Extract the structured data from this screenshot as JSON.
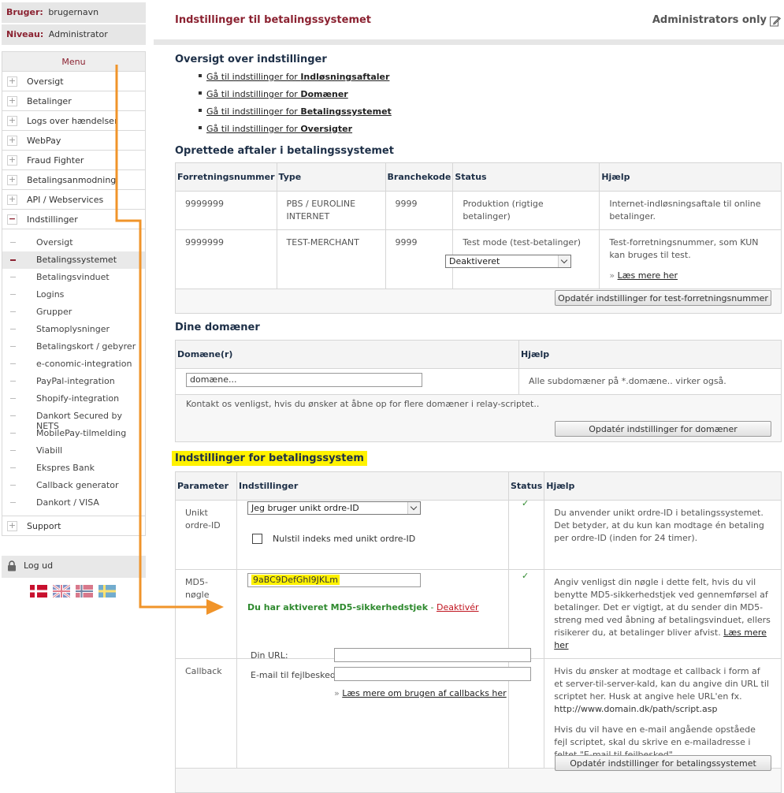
{
  "sidebar": {
    "user_label": "Bruger:",
    "user_value": "brugernavn",
    "level_label": "Niveau:",
    "level_value": "Administrator",
    "menu_title": "Menu",
    "items": [
      {
        "label": "Oversigt",
        "state": "+"
      },
      {
        "label": "Betalinger",
        "state": "+"
      },
      {
        "label": "Logs over hændelser",
        "state": "+"
      },
      {
        "label": "WebPay",
        "state": "+"
      },
      {
        "label": "Fraud Fighter",
        "state": "+"
      },
      {
        "label": "Betalingsanmodning",
        "state": "+"
      },
      {
        "label": "API / Webservices",
        "state": "+"
      },
      {
        "label": "Indstillinger",
        "state": "−"
      }
    ],
    "sub_items": [
      "Oversigt",
      "Betalingssystemet",
      "Betalingsvinduet",
      "Logins",
      "Grupper",
      "Stamoplysninger",
      "Betalingskort / gebyrer",
      "e-conomic-integration",
      "PayPal-integration",
      "Shopify-integration",
      "Dankort Secured by NETS",
      "MobilePay-tilmelding",
      "Viabill",
      "Ekspres Bank",
      "Callback generator",
      "Dankort / VISA"
    ],
    "active_sub": "Betalingssystemet",
    "support_label": "Support",
    "logout_label": "Log ud"
  },
  "header": {
    "title": "Indstillinger til betalingssystemet",
    "admin_only": "Administrators only"
  },
  "overview": {
    "heading": "Oversigt over indstillinger",
    "links": [
      {
        "prefix": "Gå til indstillinger for ",
        "bold": "Indløsningsaftaler"
      },
      {
        "prefix": "Gå til indstillinger for ",
        "bold": "Domæner"
      },
      {
        "prefix": "Gå til indstillinger for ",
        "bold": "Betalingssystemet"
      },
      {
        "prefix": "Gå til indstillinger for ",
        "bold": "Oversigter"
      }
    ]
  },
  "agreements": {
    "heading": "Oprettede aftaler i betalingssystemet",
    "columns": [
      "Forretningsnummer",
      "Type",
      "Branchekode",
      "Status",
      "Hjælp"
    ],
    "rows": [
      {
        "number": "9999999",
        "type": "PBS / EUROLINE INTERNET",
        "code": "9999",
        "status": "Produktion (rigtige betalinger)",
        "help": "Internet-indløsningsaftale til online betalinger."
      },
      {
        "number": "9999999",
        "type": "TEST-MERCHANT",
        "code": "9999",
        "status": "Test mode (test-betalinger)",
        "help": "Test-forretningsnummer, som KUN kan bruges til test."
      }
    ],
    "test_select": "Deaktiveret",
    "read_more": "Læs mere her",
    "button": "Opdatér indstillinger for test-forretningsnummer"
  },
  "domains": {
    "heading": "Dine domæner",
    "columns": [
      "Domæne(r)",
      "Hjælp"
    ],
    "input_value": "domæne...",
    "help": "Alle subdomæner på *.domæne.. virker også.",
    "contact": "Kontakt os venligst, hvis du ønsker at åbne op for flere domæner i relay-scriptet..",
    "button": "Opdatér indstillinger for domæner"
  },
  "payment": {
    "heading": "Indstillinger for betalingssystem",
    "columns": [
      "Parameter",
      "Indstillinger",
      "Status",
      "Hjælp"
    ],
    "order_id_label": "Unikt ordre-ID",
    "order_id_select": "Jeg bruger unikt ordre-ID",
    "order_id_checkbox": "Nulstil indeks med unikt ordre-ID",
    "order_id_help": "Du anvender unikt ordre-ID i betalingssystemet. Det betyder, at du kun kan modtage én betaling per ordre-ID (inden for 24 timer).",
    "md5_label": "MD5-nøgle",
    "md5_value": "9aBC9DefGhI9JKLm",
    "md5_active": "Du har aktiveret MD5-sikkerhedstjek",
    "md5_sep": " - ",
    "md5_deactivate": "Deaktivér",
    "md5_help": "Angiv venligst din nøgle i dette felt, hvis du vil benytte MD5-sikkerhedstjek ved gennemførsel af betalinger. Det er vigtigt, at du sender din MD5-streng med ved åbning af betalingsvinduet, ellers risikerer du, at betalinger bliver afvist.",
    "md5_help_link": "Læs mere her",
    "callback_label": "Callback",
    "url_label": "Din URL:",
    "email_label": "E-mail til fejlbesked:",
    "callback_more": "Læs mere om brugen af callbacks her",
    "callback_help1": "Hvis du ønsker at modtage et callback i form af et server-til-server-kald, kan du angive din URL til scriptet her. Husk at angive hele URL'en fx.",
    "callback_url_example": "http://www.domain.dk/path/script.asp",
    "callback_help2": "Hvis du vil have en e-mail angående opståede fejl scriptet, skal du skrive en e-mailadresse i feltet \"E-mail til fejlbesked\".",
    "button": "Opdatér indstillinger for betalingssystemet",
    "status_check": "✓"
  },
  "colors": {
    "accent": "#8b2231",
    "heading": "#1d2f47",
    "arrow": "#f0942a",
    "highlight": "#fff200",
    "ok": "#2f8a2f"
  }
}
